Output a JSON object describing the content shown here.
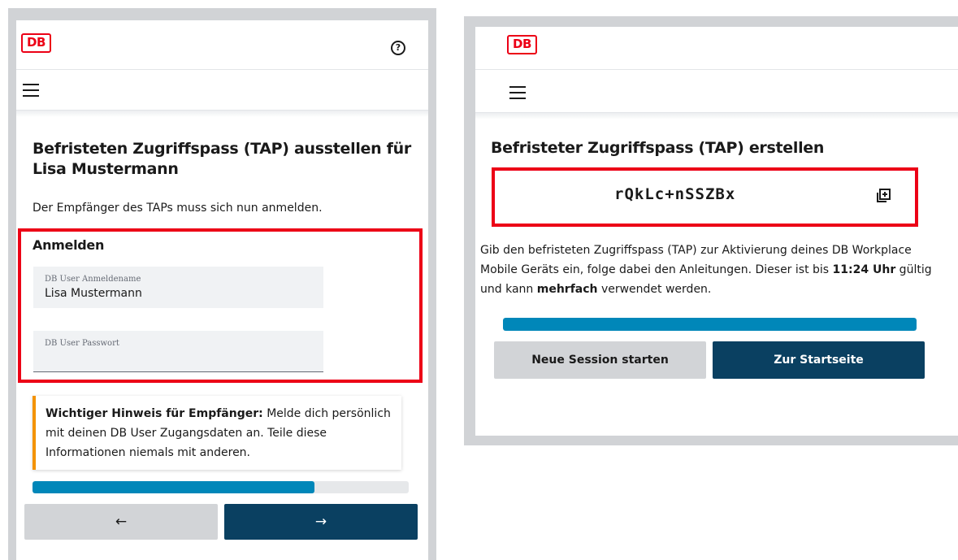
{
  "left_screen": {
    "brand_logo": "DB",
    "help_icon": "?",
    "title": "Befristeten Zugriffspass (TAP) ausstellen für Lisa Mustermann",
    "info_text": "Der Empfänger des TAPs muss sich nun anmelden.",
    "login": {
      "heading": "Anmelden",
      "username_label": "DB User Anmeldename",
      "username_value": "Lisa Mustermann",
      "password_label": "DB User Passwort",
      "password_value": ""
    },
    "hint": {
      "strong": "Wichtiger Hinweis für Empfänger:",
      "text": " Melde dich persönlich mit deinen DB User Zugangsdaten an. Teile diese Informationen niemals mit anderen."
    },
    "progress_percent": 75,
    "back_button": "←",
    "next_button": "→"
  },
  "right_screen": {
    "brand_logo": "DB",
    "title": "Befristeter Zugriffspass (TAP) erstellen",
    "tap_code": "rQkLc+nSSZBx",
    "description": {
      "part1": "Gib den befristeten Zugriffspass (TAP) zur Aktivierung deines DB Workplace Mobile Geräts ein, folge dabei den Anleitungen. Dieser ist bis ",
      "time": "11:24 Uhr",
      "part2": " gültig und kann ",
      "multi": "mehrfach",
      "part3": " verwendet werden."
    },
    "progress_percent": 100,
    "new_session_button": "Neue Session starten",
    "home_button": "Zur Startseite"
  },
  "colors": {
    "db_red": "#ec0016",
    "progress_blue": "#0087b9",
    "primary_button": "#0a4061",
    "secondary_button": "#d2d4d7",
    "hint_accent": "#f39200"
  },
  "icons": {
    "help": "question-circle-icon",
    "menu": "hamburger-menu-icon",
    "copy": "copy-icon",
    "back": "arrow-left-icon",
    "next": "arrow-right-icon"
  }
}
